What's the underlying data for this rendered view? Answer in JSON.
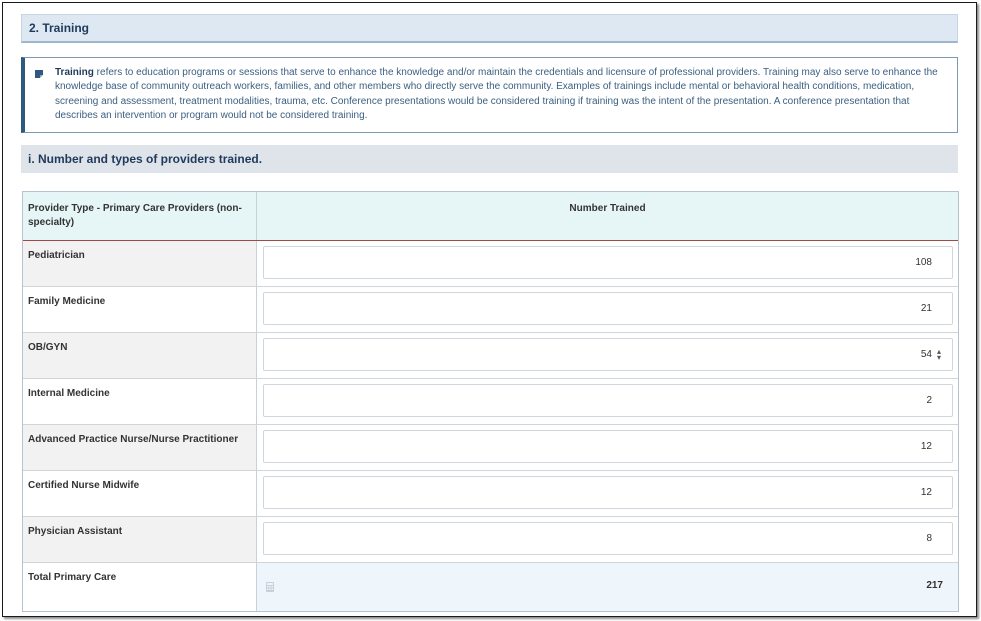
{
  "section": {
    "title": "2. Training"
  },
  "info": {
    "term": "Training",
    "text": " refers to education programs or sessions that serve to enhance the knowledge and/or maintain the credentials and licensure of professional providers. Training may also serve to enhance the knowledge base of community outreach workers, families, and other members who directly serve the community. Examples of trainings include mental or behavioral health conditions, medication, screening and assessment, treatment modalities, trauma, etc. Conference presentations would be considered training if training was the intent of the presentation. A conference presentation that describes an intervention or program would not be considered training.",
    "icon": "note-icon"
  },
  "subsection": {
    "title": "i.  Number and types of providers trained."
  },
  "table": {
    "col_provider": "Provider Type - Primary Care Providers (non-specialty)",
    "col_number": "Number Trained",
    "rows": [
      {
        "label": "Pediatrician",
        "value": "108"
      },
      {
        "label": "Family Medicine",
        "value": "21"
      },
      {
        "label": "OB/GYN",
        "value": "54"
      },
      {
        "label": "Internal Medicine",
        "value": "2"
      },
      {
        "label": "Advanced Practice Nurse/Nurse Practitioner",
        "value": "12"
      },
      {
        "label": "Certified Nurse Midwife",
        "value": "12"
      },
      {
        "label": "Physician Assistant",
        "value": "8"
      }
    ],
    "total_label": "Total Primary Care",
    "total_value": "217",
    "total_icon": "calculator-icon"
  },
  "colors": {
    "header_bg": "#dde8f3",
    "info_border": "#2e5a82",
    "table_header_bg": "#e6f6f6",
    "total_bg": "#eef5fb"
  }
}
